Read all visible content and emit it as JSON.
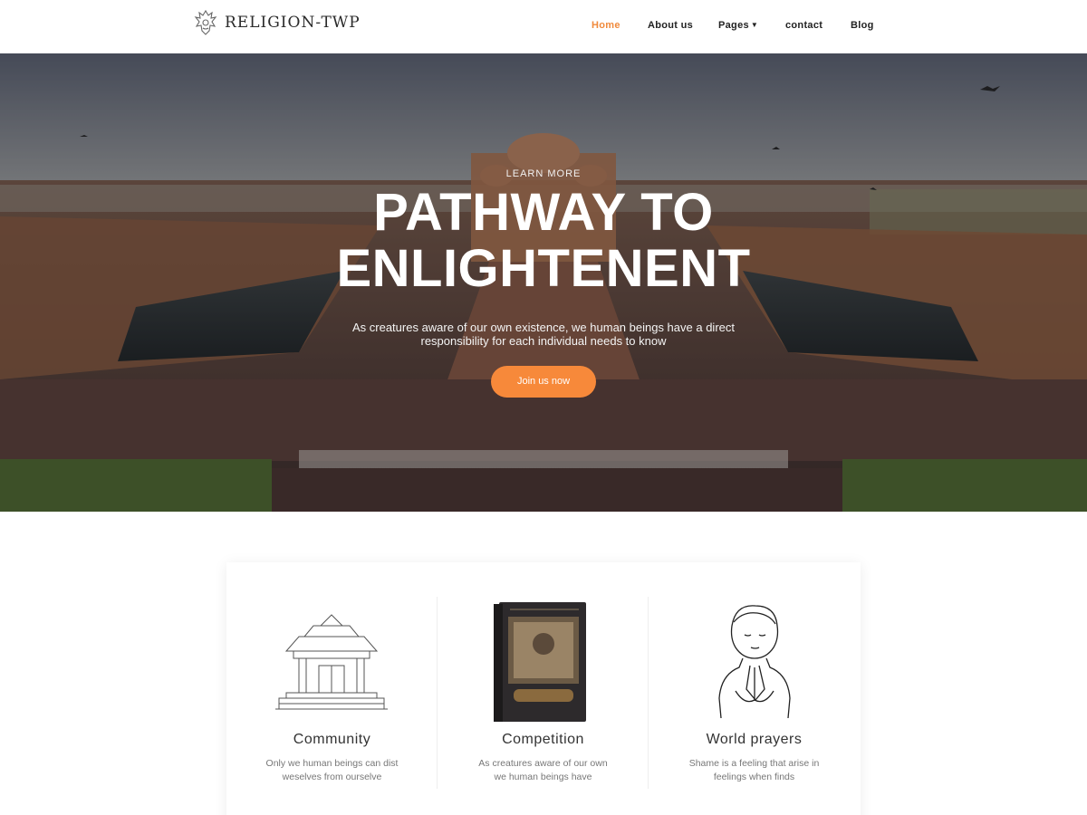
{
  "brand": {
    "name": "RELIGION-TWP"
  },
  "nav": {
    "items": [
      {
        "label": "Home",
        "active": true
      },
      {
        "label": "About us",
        "active": false
      },
      {
        "label": "Pages",
        "active": false,
        "has_dropdown": true
      },
      {
        "label": "contact",
        "active": false
      },
      {
        "label": "Blog",
        "active": false
      }
    ]
  },
  "hero": {
    "eyebrow": "LEARN MORE",
    "title_line1": "PATHWAY TO",
    "title_line2": "ENLIGHTENENT",
    "subtitle_line1": "As creatures aware of our own existence, we human beings have a direct",
    "subtitle_line2": "responsibility for each individual needs to know",
    "cta_label": "Join us now"
  },
  "features": [
    {
      "title": "Community",
      "text_line1": "Only we human beings can dist",
      "text_line2": "weselves from ourselve",
      "icon": "temple-icon"
    },
    {
      "title": "Competition",
      "text_line1": "As creatures aware of our own",
      "text_line2": "we human beings have",
      "icon": "book-icon"
    },
    {
      "title": "World prayers",
      "text_line1": "Shame is a feeling that arise in",
      "text_line2": "feelings when finds",
      "icon": "praying-child-icon"
    }
  ],
  "colors": {
    "accent": "#f7893a",
    "nav_active": "#f08a3c",
    "text_dark": "#222222"
  }
}
